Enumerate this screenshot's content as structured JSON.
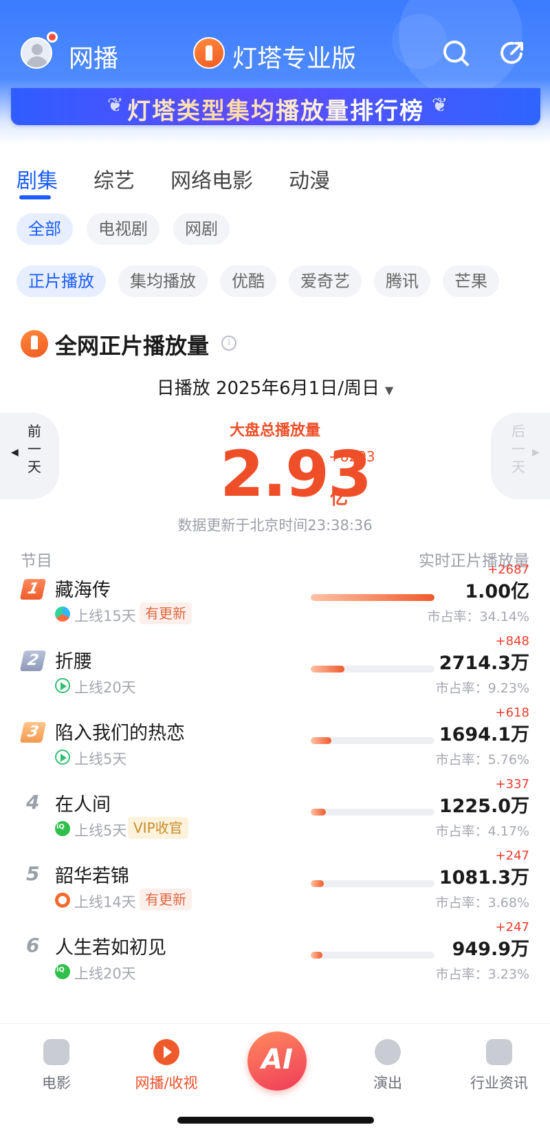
{
  "header": {
    "app_title": "网播",
    "brand_title": "灯塔专业版",
    "banner_text": "灯塔类型集均播放量排行榜"
  },
  "tabs": [
    {
      "label": "剧集",
      "active": true
    },
    {
      "label": "综艺",
      "active": false
    },
    {
      "label": "网络电影",
      "active": false
    },
    {
      "label": "动漫",
      "active": false
    }
  ],
  "filters_type": [
    "全部",
    "电视剧",
    "网剧"
  ],
  "filters_metric": [
    "正片播放",
    "集均播放",
    "优酷",
    "爱奇艺",
    "腾讯",
    "芒果"
  ],
  "section": {
    "title": "全网正片播放量",
    "date_line": "日播放  2025年6月1日/周日",
    "prev_label": "前一天",
    "next_label": "后一天",
    "total_label": "大盘总播放量",
    "total_value": "2.93",
    "total_unit": "亿",
    "total_delta": "+8203",
    "update_text": "数据更新于北京时间23:38:36",
    "col_left": "节目",
    "col_right": "实时正片播放量"
  },
  "rows": [
    {
      "rank": "1",
      "name": "藏海传",
      "platform": "youku",
      "online": "上线15天",
      "tag": "有更新",
      "tag_type": "update",
      "delta": "+2687",
      "value": "1.00亿",
      "share": "市占率：34.14%",
      "share_pct": 34.14
    },
    {
      "rank": "2",
      "name": "折腰",
      "platform": "tencent",
      "online": "上线20天",
      "tag": "",
      "tag_type": "",
      "delta": "+848",
      "value": "2714.3万",
      "share": "市占率：9.23%",
      "share_pct": 9.23
    },
    {
      "rank": "3",
      "name": "陷入我们的热恋",
      "platform": "tencent",
      "online": "上线5天",
      "tag": "",
      "tag_type": "",
      "delta": "+618",
      "value": "1694.1万",
      "share": "市占率：5.76%",
      "share_pct": 5.76
    },
    {
      "rank": "4",
      "name": "在人间",
      "platform": "iqiyi",
      "online": "上线5天",
      "tag": "VIP收官",
      "tag_type": "vip",
      "delta": "+337",
      "value": "1225.0万",
      "share": "市占率：4.17%",
      "share_pct": 4.17
    },
    {
      "rank": "5",
      "name": "韶华若锦",
      "platform": "mango",
      "online": "上线14天",
      "tag": "有更新",
      "tag_type": "update",
      "delta": "+247",
      "value": "1081.3万",
      "share": "市占率：3.68%",
      "share_pct": 3.68
    },
    {
      "rank": "6",
      "name": "人生若如初见",
      "platform": "iqiyi",
      "online": "上线20天",
      "tag": "",
      "tag_type": "",
      "delta": "+247",
      "value": "949.9万",
      "share": "市占率：3.23%",
      "share_pct": 3.23
    }
  ],
  "bottom_nav": [
    {
      "label": "电影",
      "icon": "film-icon",
      "active": false
    },
    {
      "label": "网播/收视",
      "icon": "play-icon",
      "active": true
    },
    {
      "label": "",
      "icon": "ai-icon",
      "active": false
    },
    {
      "label": "演出",
      "icon": "microphone-icon",
      "active": false
    },
    {
      "label": "行业资讯",
      "icon": "news-icon",
      "active": false
    }
  ],
  "colors": {
    "accent": "#1a5cff",
    "highlight": "#ee4f28"
  }
}
